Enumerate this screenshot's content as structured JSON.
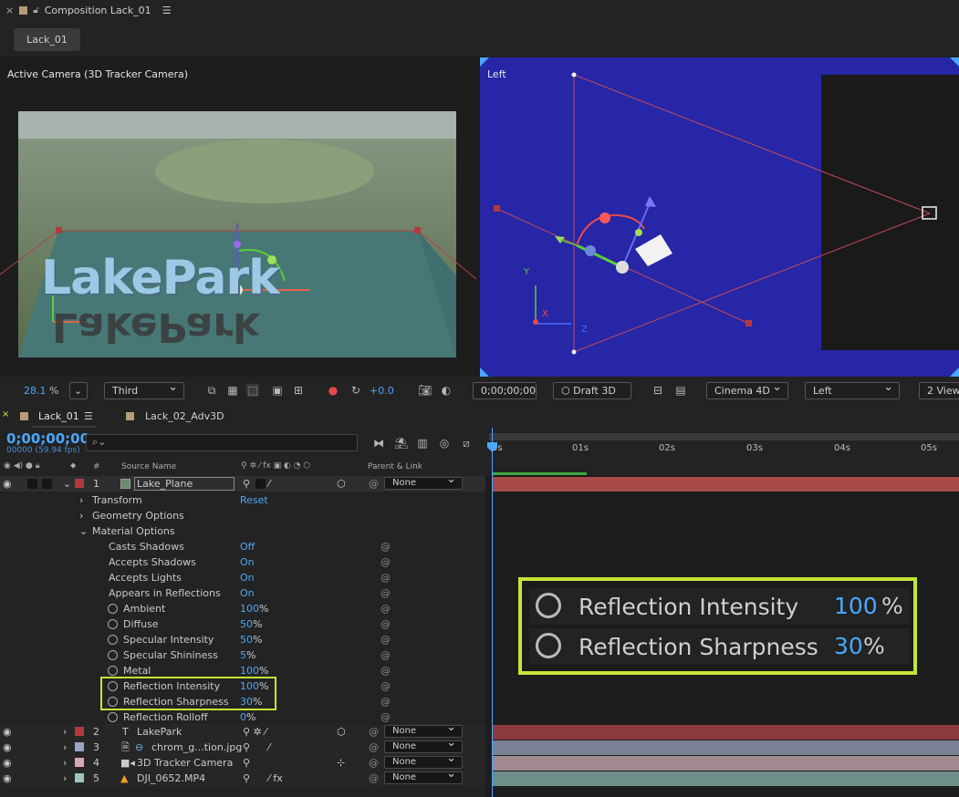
{
  "comp_panel": {
    "close": "×",
    "title": "Composition Lack_01",
    "menu": "☰",
    "chip": "Lack_01"
  },
  "viewer_left": {
    "label": "Active Camera (3D Tracker Camera)",
    "text3d": "LakePark"
  },
  "viewer_right": {
    "label": "Left",
    "axis_y": "Y",
    "axis_x": "X",
    "axis_z": "Z"
  },
  "viewer_bar": {
    "zoom": "28.1",
    "zoom_unit": "%",
    "resolution": "Third",
    "exposure": "+0.0",
    "timecode": "0;00;00;00",
    "renderer_btn": "Draft 3D",
    "renderer": "Cinema 4D",
    "view": "Left",
    "views": "2 Views"
  },
  "timeline": {
    "tabs": [
      {
        "label": "Lack_01",
        "menu": "☰"
      },
      {
        "label": "Lack_02_Adv3D"
      }
    ],
    "timecode": "0;00;00;00",
    "fps": "00000 (59.94 fps)",
    "cols": {
      "num": "#",
      "source": "Source Name",
      "parent": "Parent & Link"
    },
    "ruler": [
      "0s",
      "01s",
      "02s",
      "03s",
      "04s",
      "05s"
    ],
    "layers": [
      {
        "num": "1",
        "name": "Lake_Plane",
        "parent": "None",
        "color": "#b23a3a"
      },
      {
        "num": "2",
        "name": "LakePark",
        "parent": "None",
        "color": "#b23a3a"
      },
      {
        "num": "3",
        "name": "chrom_g...tion.jpg",
        "parent": "None",
        "color": "#9aa3c9"
      },
      {
        "num": "4",
        "name": "3D Tracker Camera",
        "parent": "None",
        "color": "#d8a7b1"
      },
      {
        "num": "5",
        "name": "DJI_0652.MP4",
        "parent": "None",
        "color": "#9fc5c0"
      }
    ],
    "groups": {
      "transform": "Transform",
      "transform_val": "Reset",
      "geometry": "Geometry Options",
      "material": "Material Options"
    },
    "props": [
      {
        "name": "Casts Shadows",
        "value": "Off",
        "stop": false
      },
      {
        "name": "Accepts Shadows",
        "value": "On",
        "stop": false
      },
      {
        "name": "Accepts Lights",
        "value": "On",
        "stop": false
      },
      {
        "name": "Appears in Reflections",
        "value": "On",
        "stop": false
      },
      {
        "name": "Ambient",
        "value": "100",
        "unit": "%",
        "stop": true
      },
      {
        "name": "Diffuse",
        "value": "50",
        "unit": "%",
        "stop": true
      },
      {
        "name": "Specular Intensity",
        "value": "50",
        "unit": "%",
        "stop": true
      },
      {
        "name": "Specular Shininess",
        "value": "5",
        "unit": "%",
        "stop": true
      },
      {
        "name": "Metal",
        "value": "100",
        "unit": "%",
        "stop": true
      },
      {
        "name": "Reflection Intensity",
        "value": "100",
        "unit": "%",
        "stop": true
      },
      {
        "name": "Reflection Sharpness",
        "value": "30",
        "unit": "%",
        "stop": true
      },
      {
        "name": "Reflection Rolloff",
        "value": "0",
        "unit": "%",
        "stop": true
      }
    ]
  },
  "callout": {
    "row1_label": "Reflection Intensity",
    "row1_value": "100",
    "row1_unit": "%",
    "row2_label": "Reflection Sharpness",
    "row2_value": "30",
    "row2_unit": "%"
  }
}
